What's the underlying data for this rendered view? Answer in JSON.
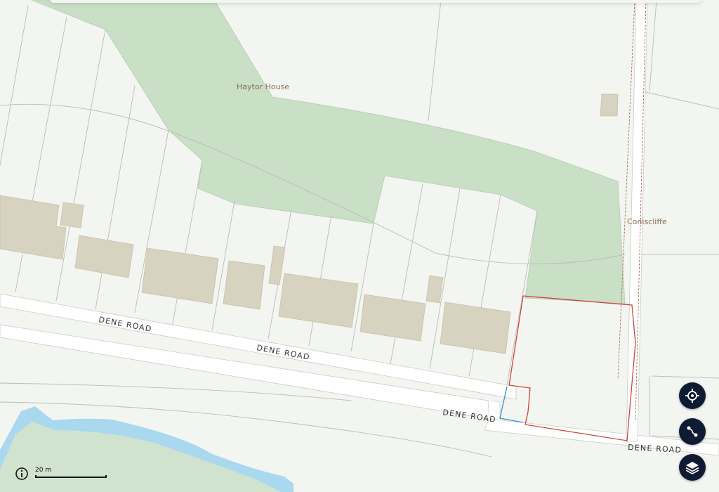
{
  "map": {
    "place_labels": [
      "Haytor House",
      "Coniscliffe"
    ],
    "road_labels": [
      "DENE ROAD",
      "DENE ROAD",
      "DENE ROAD",
      "DENE ROAD"
    ],
    "colors": {
      "background": "#f3f5f0",
      "woodland": "#c9dfc6",
      "building": "#d8d2c0",
      "road": "#ffffff",
      "water": "#a9d8ef",
      "site_boundary": "#d0443c",
      "access_line": "#3d8fd6"
    }
  },
  "controls": {
    "recenter_icon": "crosshair-icon",
    "route_icon": "route-icon",
    "layers_icon": "layers-icon",
    "info_icon": "info-icon"
  },
  "scale": {
    "label": "20 m"
  }
}
